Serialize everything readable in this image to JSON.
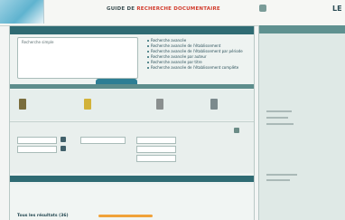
{
  "header": {
    "title_prefix": "GUIDE DE",
    "title_accent": "RECHERCHE DOCUMENTAIRE",
    "top_link": "",
    "right_title": "LE"
  },
  "search": {
    "panel_title": "",
    "label": "Recherche simple",
    "button_label": "",
    "options": [
      "Recherche avancée",
      "Recherche avancée de l'établissement",
      "Recherche avancée de l'établissement par période",
      "Recherche avancée par auteur",
      "Recherche avancée par titre",
      "Recherche avancée de l'établissement complète"
    ]
  },
  "types": {
    "heading": "",
    "items": [
      {
        "label": "",
        "color": "#7a6d3d"
      },
      {
        "label": "",
        "color": "#d2b23a"
      },
      {
        "label": "",
        "color": "#8a8f8f"
      },
      {
        "label": "",
        "color": "#7b8a8d"
      }
    ]
  },
  "filters": {
    "label1": "",
    "label2": "",
    "label3": ""
  },
  "results": {
    "title": "Tous les résultats (36)",
    "red_text": "",
    "footer_red": "",
    "footer_text": ""
  },
  "sidebar": {
    "title": "",
    "links": [
      "",
      "",
      ""
    ]
  },
  "colors": {
    "accent": "#2f6b73",
    "title_accent": "#d23b2c",
    "button": "#2d7e94"
  }
}
